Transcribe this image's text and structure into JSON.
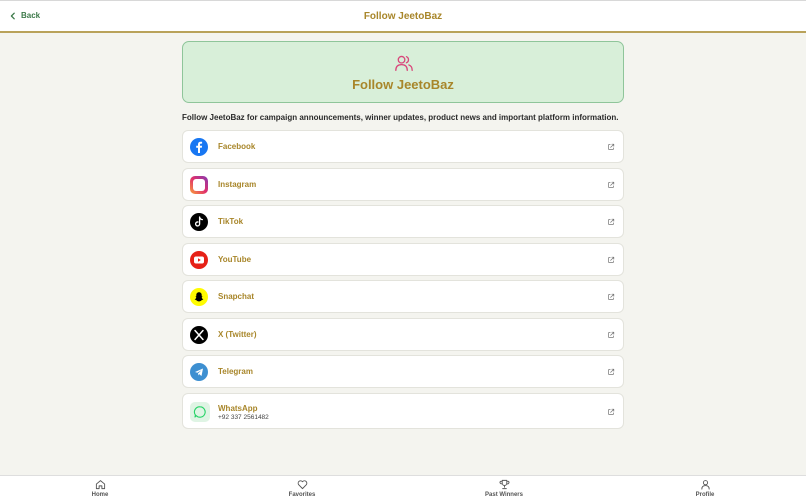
{
  "header": {
    "back_label": "Back",
    "title": "Follow JeetoBaz"
  },
  "hero": {
    "icon": "users-icon",
    "title": "Follow JeetoBaz"
  },
  "intro": "Follow JeetoBaz for campaign announcements, winner updates, product news and important platform information.",
  "socials": [
    {
      "label": "Facebook",
      "icon": "facebook-icon",
      "color": "#1877f2"
    },
    {
      "label": "Instagram",
      "icon": "instagram-icon",
      "color": "#c13584"
    },
    {
      "label": "TikTok",
      "icon": "tiktok-icon",
      "color": "#000000"
    },
    {
      "label": "YouTube",
      "icon": "youtube-icon",
      "color": "#e62117"
    },
    {
      "label": "Snapchat",
      "icon": "snapchat-icon",
      "color": "#fffc00"
    },
    {
      "label": "X (Twitter)",
      "icon": "x-icon",
      "color": "#000000"
    },
    {
      "label": "Telegram",
      "icon": "telegram-icon",
      "color": "#3d8fd1"
    },
    {
      "label": "WhatsApp",
      "sub": "+92 337 2561482",
      "icon": "whatsapp-icon",
      "color": "#25d366"
    }
  ],
  "bottom_nav": [
    {
      "label": "Home",
      "icon": "home-icon"
    },
    {
      "label": "Favorites",
      "icon": "heart-icon"
    },
    {
      "label": "Past Winners",
      "icon": "trophy-icon"
    },
    {
      "label": "Profile",
      "icon": "user-icon"
    }
  ],
  "colors": {
    "accent_gold": "#a8862a",
    "back_green": "#3d7a4a",
    "hero_bg": "#d8efd9",
    "hero_icon": "#d9467a"
  }
}
